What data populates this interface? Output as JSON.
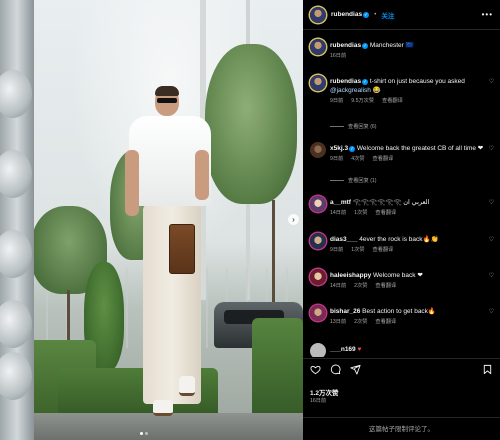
{
  "post_header": {
    "username": "rubendias",
    "separator": "•",
    "follow_label": "关注",
    "more_label": "•••"
  },
  "caption": {
    "username": "rubendias",
    "text": "Manchester 🇪🇺",
    "time": "16日前"
  },
  "comments": [
    {
      "username": "rubendias",
      "text": "t-shirt on just because you asked",
      "mention": "@jackgrealish",
      "emoji": "😂",
      "time": "9日前",
      "likes": "9.5万次赞",
      "reply": "查看翻译",
      "replies": "查看回复 (6)"
    },
    {
      "username": "x5kj.3",
      "text": "Welcome back the greatest CB of all time ❤",
      "time": "9日前",
      "likes": "4次赞",
      "reply": "查看翻译",
      "replies": "查看回复 (1)"
    },
    {
      "username": "a__mtf",
      "text": "𓂀𓂀𓂀𓂀𓂀𓂀 العربي ان",
      "time": "14日前",
      "likes": "1次赞",
      "reply": "查看翻译"
    },
    {
      "username": "dias3___",
      "text": "4ever the rock is back🔥👏",
      "time": "9日前",
      "likes": "1次赞",
      "reply": "查看翻译"
    },
    {
      "username": "haleeishappy",
      "text": "Welcome back ❤",
      "time": "14日前",
      "likes": "2次赞",
      "reply": "查看翻译"
    },
    {
      "username": "bishar_26",
      "text": "Best action to get back🔥",
      "time": "13日前",
      "likes": "2次赞",
      "reply": "查看翻译"
    },
    {
      "username": "___n169",
      "text": "♥"
    }
  ],
  "actions": {
    "likes_count": "1.2万次赞",
    "posted_ago": "16日前"
  },
  "footer": {
    "text": "这篇帖子限制评论了。"
  },
  "icons": [
    "heart-icon",
    "comment-icon",
    "share-icon",
    "save-icon",
    "verified-icon",
    "more-icon",
    "next-arrow-icon"
  ],
  "colors": {
    "accent": "#0095f6",
    "background": "#000000",
    "muted": "#a8a8a8"
  }
}
